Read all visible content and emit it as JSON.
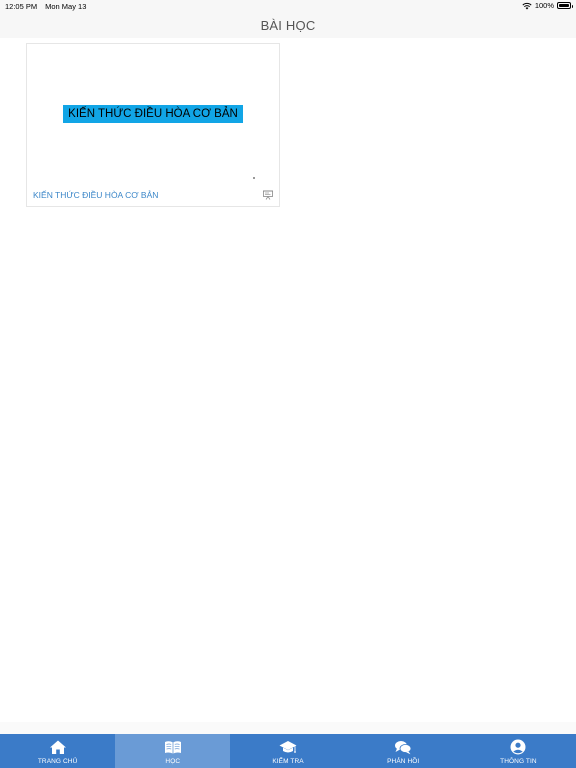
{
  "status_bar": {
    "time": "12:05 PM",
    "date": "Mon May 13",
    "battery_percent": "100%",
    "battery_level": 1.0,
    "wifi_icon": "wifi-icon",
    "battery_icon": "battery-icon"
  },
  "nav": {
    "title": "BÀI HỌC"
  },
  "lessons": [
    {
      "thumbnail_text": "KIẾN THỨC ĐIỀU HÒA CƠ BẢN",
      "title": "KIẾN THỨC ĐIỀU HÒA CƠ BẢN",
      "icon": "presentation-icon",
      "banner_color": "#11a5e6"
    }
  ],
  "tab_bar": {
    "background": "#3b7bc8",
    "active_background": "#6a9bd6",
    "active_index": 1,
    "tabs": [
      {
        "label": "TRANG CHỦ",
        "icon": "home-icon"
      },
      {
        "label": "HỌC",
        "icon": "book-icon"
      },
      {
        "label": "KIỂM TRA",
        "icon": "graduation-cap-icon"
      },
      {
        "label": "PHẢN HỒI",
        "icon": "chat-bubbles-icon"
      },
      {
        "label": "THÔNG TIN",
        "icon": "user-icon"
      }
    ]
  }
}
